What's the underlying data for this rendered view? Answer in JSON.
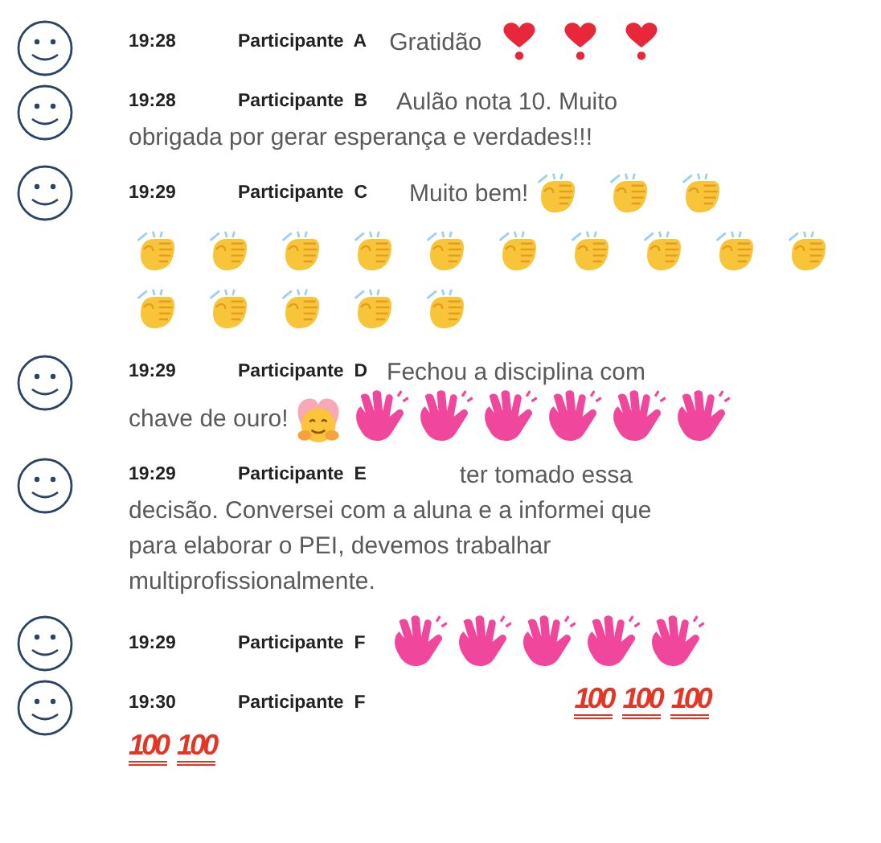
{
  "messages": [
    {
      "time": "19:28",
      "author": "Participante  A",
      "lines": [
        [
          {
            "kind": "text",
            "text": "Gratidão"
          },
          {
            "kind": "heart"
          },
          {
            "kind": "heart"
          },
          {
            "kind": "heart"
          }
        ]
      ]
    },
    {
      "time": "19:28",
      "author": "Participante  B",
      "lines": [
        [
          {
            "kind": "text",
            "text": "Aulão nota 10. Muito"
          }
        ],
        [
          {
            "kind": "text",
            "text": "obrigada por gerar esperança e verdades!!!"
          }
        ]
      ]
    },
    {
      "time": "19:29",
      "author": "Participante  C",
      "lines": [
        [
          {
            "kind": "text",
            "text": "Muito bem!"
          },
          {
            "kind": "clap"
          },
          {
            "kind": "clap"
          },
          {
            "kind": "clap"
          }
        ],
        [
          {
            "kind": "clap"
          },
          {
            "kind": "clap"
          },
          {
            "kind": "clap"
          },
          {
            "kind": "clap"
          },
          {
            "kind": "clap"
          },
          {
            "kind": "clap"
          },
          {
            "kind": "clap"
          },
          {
            "kind": "clap"
          },
          {
            "kind": "clap"
          },
          {
            "kind": "clap"
          }
        ],
        [
          {
            "kind": "clap"
          },
          {
            "kind": "clap"
          },
          {
            "kind": "clap"
          },
          {
            "kind": "clap"
          },
          {
            "kind": "clap"
          }
        ]
      ]
    },
    {
      "time": "19:29",
      "author": "Participante  D",
      "lines": [
        [
          {
            "kind": "text",
            "text": "Fechou a disciplina com"
          }
        ],
        [
          {
            "kind": "text",
            "text": "chave de ouro!"
          },
          {
            "kind": "hug"
          },
          {
            "kind": "wave"
          },
          {
            "kind": "wave"
          },
          {
            "kind": "wave"
          },
          {
            "kind": "wave"
          },
          {
            "kind": "wave"
          },
          {
            "kind": "wave"
          }
        ]
      ]
    },
    {
      "time": "19:29",
      "author": "Participante  E",
      "lines": [
        [
          {
            "kind": "text",
            "text": "ter tomado essa"
          }
        ],
        [
          {
            "kind": "text",
            "text": "decisão. Conversei com a aluna e a informei que"
          }
        ],
        [
          {
            "kind": "text",
            "text": "para elaborar o PEI, devemos trabalhar"
          }
        ],
        [
          {
            "kind": "text",
            "text": "multiprofissionalmente."
          }
        ]
      ]
    },
    {
      "time": "19:29",
      "author": "Participante  F",
      "lines": [
        [
          {
            "kind": "wave"
          },
          {
            "kind": "wave"
          },
          {
            "kind": "wave"
          },
          {
            "kind": "wave"
          },
          {
            "kind": "wave"
          }
        ]
      ]
    },
    {
      "time": "19:30",
      "author": "Participante  F",
      "lines": [
        [
          {
            "kind": "hundred",
            "text": "100"
          },
          {
            "kind": "hundred",
            "text": "100"
          },
          {
            "kind": "hundred",
            "text": "100"
          }
        ],
        [
          {
            "kind": "hundred",
            "text": "100"
          },
          {
            "kind": "hundred",
            "text": "100"
          }
        ]
      ]
    }
  ]
}
